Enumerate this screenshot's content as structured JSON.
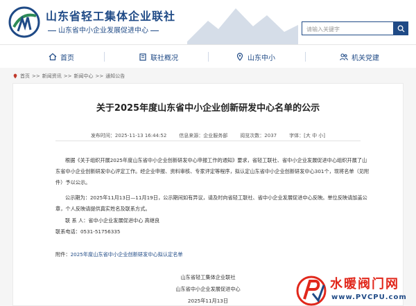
{
  "header": {
    "org_title": "山东省轻工集体企业联社",
    "org_subtitle": "山东省中小企业发展促进中心",
    "search_placeholder": "请输入关键字"
  },
  "nav": [
    {
      "label": "首页",
      "icon": "home-icon"
    },
    {
      "label": "联社概况",
      "icon": "building-icon"
    },
    {
      "label": "山东中小",
      "icon": "map-pin-icon"
    },
    {
      "label": "机关党建",
      "icon": "people-icon"
    }
  ],
  "breadcrumb": [
    "首页",
    "新闻资讯",
    "新闻中心",
    "通知公告"
  ],
  "breadcrumb_sep": ">>",
  "article": {
    "title": "关于2025年度山东省中小企业创新研发中心名单的公示",
    "meta": {
      "publish_time": "发布时间：2025-11-13 16:44:52",
      "source": "信息来源：企业服务部",
      "views": "阅览次数：2037",
      "font_size": "字体：[大 中 小]"
    },
    "body_p1": "根据《关于组织开展2025年度山东省中小企业创新研发中心申报工作的通知》要求，省轻工联社、省中小企业发展促进中心组织开展了山东省中小企业创新研发中心评定工作。经企业申报、资料审核、专家评定等程序，拟认定山东省中小企业创新研发中心301个，现将名单（见附件）予以公示。",
    "body_p2": "公示期为：2025年11月13日—11月19日，公示期间如有异议，请及时向省轻工联社、省中小企业发展促进中心反映。单位反映请加盖公章，个人反映请提供真实姓名及联系方式。",
    "contact_person": "联 系 人：省中小企业发展促进中心 高继良",
    "contact_phone": "联系电话：0531-51756335",
    "attachment_label": "附件：",
    "attachment_link": "2025年度山东省中小企业创新研发中心拟认定名单",
    "sign_org1": "山东省轻工集体企业联社",
    "sign_org2": "山东省中小企业发展促进中心",
    "sign_date": "2025年11月13日"
  },
  "watermark": {
    "name": "水暖阀门网",
    "url": "www.PVCPU.com"
  },
  "colors": {
    "brand_blue": "#1f4a86",
    "watermark_red": "#e1271b"
  }
}
